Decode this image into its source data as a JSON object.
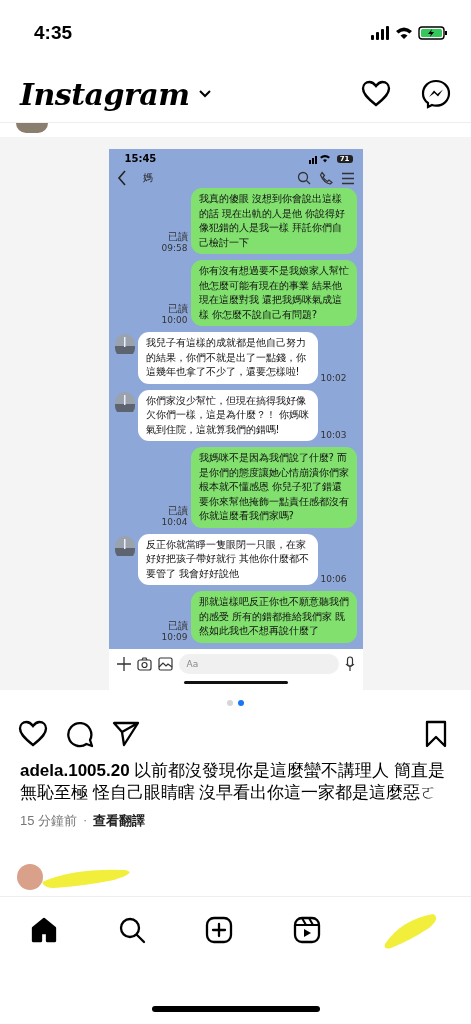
{
  "status_bar": {
    "time": "4:35"
  },
  "header": {
    "logo": "Instagram"
  },
  "post": {
    "chat": {
      "status_time": "15:45",
      "battery": "71",
      "contact": "媽",
      "input_placeholder": "Aa",
      "messages": [
        {
          "kind": "sent",
          "text": "我真的傻眼 沒想到你會說出這樣的話 現在出軌的人是他 你說得好像犯錯的人是我一樣 拜託你們自己檢討一下",
          "read": "已讀",
          "time": "09:58"
        },
        {
          "kind": "sent",
          "text": "你有沒有想過要不是我娘家人幫忙他怎麼可能有現在的事業 結果他現在這麼對我 還把我媽咪氣成這樣 你怎麼不說自己有問題?",
          "read": "已讀",
          "time": "10:00"
        },
        {
          "kind": "received",
          "text": "我兒子有這樣的成就都是他自己努力的結果，你們不就是出了一點錢，你這幾年也拿了不少了，還要怎樣啦!",
          "time": "10:02"
        },
        {
          "kind": "received",
          "text": "你們家沒少幫忙，但現在搞得我好像欠你們一樣，這是為什麼？！ 你媽咪氣到住院，這就算我們的錯嗎!",
          "time": "10:03"
        },
        {
          "kind": "sent",
          "text": "我媽咪不是因為我們說了什麼? 而是你們的態度讓她心情崩潰你們家根本就不懂感恩 你兒子犯了錯還要你來幫他掩飾一點責任感都沒有你就這麼看我們家嗎?",
          "read": "已讀",
          "time": "10:04"
        },
        {
          "kind": "received",
          "text": "反正你就當睜一隻眼閉一只眼，在家好好把孩子帶好就行 其他你什麼都不要管了  我會好好說他",
          "time": "10:06"
        },
        {
          "kind": "sent",
          "text": "那就這樣吧反正你也不願意聽我們的感受 所有的錯都推給我們家 既然如此我也不想再說什麼了",
          "read": "已讀",
          "time": "10:09"
        }
      ]
    },
    "carousel": [
      {
        "selected": false
      },
      {
        "selected": true
      }
    ],
    "caption": {
      "username": "adela.1005.20",
      "text": "以前都沒發現你是這麼蠻不講理人 簡直是無恥至極 怪自己眼睛瞎 沒早看出你這一家都是這麼惡ㄛ"
    },
    "time_ago": "15 分鐘前",
    "separator": "·",
    "translate": "查看翻譯"
  },
  "tab_bar": [
    {
      "kind": "home",
      "selected": true
    },
    {
      "kind": "search",
      "selected": false
    },
    {
      "kind": "create",
      "selected": false
    },
    {
      "kind": "reels",
      "selected": false
    },
    {
      "kind": "profile",
      "selected": false
    }
  ]
}
